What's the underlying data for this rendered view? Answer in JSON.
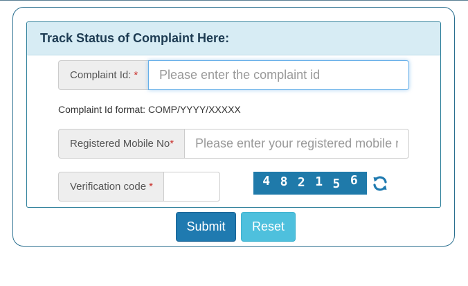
{
  "panel": {
    "heading": "Track Status of Complaint Here:"
  },
  "form": {
    "complaint_id": {
      "label": "Complaint Id:",
      "required_mark": "*",
      "placeholder": "Please enter the complaint id",
      "value": ""
    },
    "format_hint": "Complaint Id format: COMP/YYYY/XXXXX",
    "mobile": {
      "label": "Registered Mobile No",
      "required_mark": "*",
      "placeholder": "Please enter your registered mobile no",
      "value": ""
    },
    "verification": {
      "label": "Verification code",
      "required_mark": "*",
      "value": ""
    },
    "captcha": {
      "digits": [
        "4",
        "8",
        "2",
        "1",
        "5",
        "6"
      ],
      "bg_color": "#1f7aaa",
      "refresh_icon": "refresh-icon"
    }
  },
  "buttons": {
    "submit_label": "Submit",
    "reset_label": "Reset"
  },
  "colors": {
    "accent": "#1f7ab0",
    "reset": "#4ec0dd",
    "heading_bg": "#d7ecf4",
    "required": "#c9302c"
  }
}
